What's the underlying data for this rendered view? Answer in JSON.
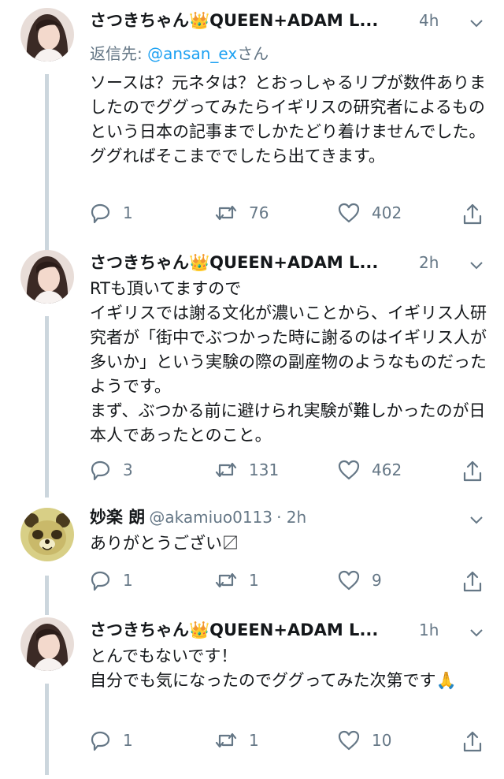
{
  "tweets": [
    {
      "name": "さつきちゃん👑QUEEN+ADAM L...",
      "handle": "",
      "time": "4h",
      "reply_prefix": "返信先: ",
      "reply_at": "@ansan_ex",
      "reply_suffix": "さん",
      "text": "ソースは？元ネタは？とおっしゃるリプが数件ありましたのでググってみたらイギリスの研究者によるものという日本の記事までしかたどり着けませんでした。\nググればそこまででしたら出てきます。",
      "replies": "1",
      "retweets": "76",
      "likes": "402"
    },
    {
      "name": "さつきちゃん👑QUEEN+ADAM L...",
      "handle": "",
      "time": "2h",
      "text": "RTも頂いてますので\nイギリスでは謝る文化が濃いことから、イギリス人研究者が「街中でぶつかった時に謝るのはイギリス人が多いか」という実験の際の副産物のようなものだったようです。\nまず、ぶつかる前に避けられ実験が難しかったのが日本人であったとのこと。",
      "replies": "3",
      "retweets": "131",
      "likes": "462"
    },
    {
      "name": "妙楽 朗",
      "handle": "@akamiuo0113",
      "time": "· 2h",
      "text": "ありがとうござい〼",
      "replies": "1",
      "retweets": "1",
      "likes": "9"
    },
    {
      "name": "さつきちゃん👑QUEEN+ADAM L...",
      "handle": "",
      "time": "1h",
      "text": "とんでもないです！\n自分でも気になったのでググってみた次第です🙏",
      "replies": "1",
      "retweets": "1",
      "likes": "10"
    }
  ],
  "icons": {
    "reply": "reply-icon",
    "retweet": "retweet-icon",
    "like": "heart-icon",
    "share": "share-icon",
    "more": "chevron-down-icon"
  },
  "colors": {
    "text": "#14171a",
    "muted": "#657786",
    "link": "#1da1f2",
    "thread_line": "#ccd6dd"
  }
}
